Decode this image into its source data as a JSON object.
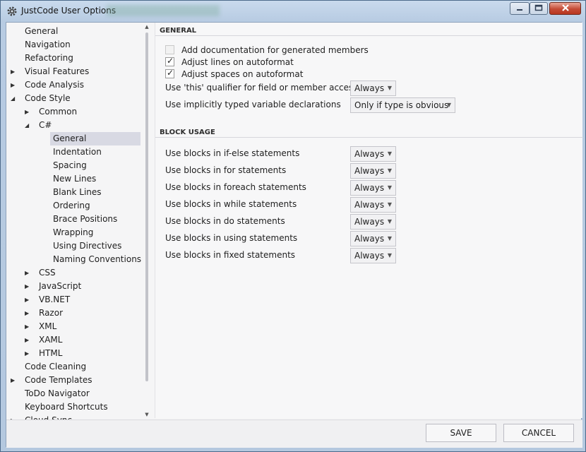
{
  "window": {
    "title": "JustCode User Options"
  },
  "tree": [
    {
      "label": "General",
      "indent": 0,
      "arrow": ""
    },
    {
      "label": "Navigation",
      "indent": 0,
      "arrow": ""
    },
    {
      "label": "Refactoring",
      "indent": 0,
      "arrow": ""
    },
    {
      "label": "Visual Features",
      "indent": 0,
      "arrow": "▶"
    },
    {
      "label": "Code Analysis",
      "indent": 0,
      "arrow": "▶"
    },
    {
      "label": "Code Style",
      "indent": 0,
      "arrow": "◢"
    },
    {
      "label": "Common",
      "indent": 1,
      "arrow": "▶"
    },
    {
      "label": "C#",
      "indent": 1,
      "arrow": "◢"
    },
    {
      "label": "General",
      "indent": 2,
      "arrow": "",
      "selected": true
    },
    {
      "label": "Indentation",
      "indent": 2,
      "arrow": ""
    },
    {
      "label": "Spacing",
      "indent": 2,
      "arrow": ""
    },
    {
      "label": "New Lines",
      "indent": 2,
      "arrow": ""
    },
    {
      "label": "Blank Lines",
      "indent": 2,
      "arrow": ""
    },
    {
      "label": "Ordering",
      "indent": 2,
      "arrow": ""
    },
    {
      "label": "Brace Positions",
      "indent": 2,
      "arrow": ""
    },
    {
      "label": "Wrapping",
      "indent": 2,
      "arrow": ""
    },
    {
      "label": "Using Directives",
      "indent": 2,
      "arrow": ""
    },
    {
      "label": "Naming Conventions",
      "indent": 2,
      "arrow": ""
    },
    {
      "label": "CSS",
      "indent": 1,
      "arrow": "▶"
    },
    {
      "label": "JavaScript",
      "indent": 1,
      "arrow": "▶"
    },
    {
      "label": "VB.NET",
      "indent": 1,
      "arrow": "▶"
    },
    {
      "label": "Razor",
      "indent": 1,
      "arrow": "▶"
    },
    {
      "label": "XML",
      "indent": 1,
      "arrow": "▶"
    },
    {
      "label": "XAML",
      "indent": 1,
      "arrow": "▶"
    },
    {
      "label": "HTML",
      "indent": 1,
      "arrow": "▶"
    },
    {
      "label": "Code Cleaning",
      "indent": 0,
      "arrow": ""
    },
    {
      "label": "Code Templates",
      "indent": 0,
      "arrow": "▶"
    },
    {
      "label": "ToDo Navigator",
      "indent": 0,
      "arrow": ""
    },
    {
      "label": "Keyboard Shortcuts",
      "indent": 0,
      "arrow": ""
    },
    {
      "label": "Cloud Sync",
      "indent": 0,
      "arrow": "▶"
    }
  ],
  "general": {
    "header": "GENERAL",
    "checkboxes": [
      {
        "label": "Add documentation for generated members",
        "checked": false,
        "disabled": true
      },
      {
        "label": "Adjust lines on autoformat",
        "checked": true,
        "disabled": false
      },
      {
        "label": "Adjust spaces on autoformat",
        "checked": true,
        "disabled": false
      }
    ],
    "options": [
      {
        "label": "Use 'this' qualifier for field or member accesses",
        "value": "Always"
      },
      {
        "label": "Use implicitly typed variable declarations",
        "value": "Only if type is obvious"
      }
    ]
  },
  "block_usage": {
    "header": "BLOCK USAGE",
    "options": [
      {
        "label": "Use blocks in if-else statements",
        "value": "Always"
      },
      {
        "label": "Use blocks in for statements",
        "value": "Always"
      },
      {
        "label": "Use blocks in foreach statements",
        "value": "Always"
      },
      {
        "label": "Use blocks in while statements",
        "value": "Always"
      },
      {
        "label": "Use blocks in do statements",
        "value": "Always"
      },
      {
        "label": "Use blocks in using statements",
        "value": "Always"
      },
      {
        "label": "Use blocks in fixed statements",
        "value": "Always"
      }
    ]
  },
  "footer": {
    "save_label": "SAVE",
    "cancel_label": "CANCEL"
  },
  "icons": {
    "app": "gear-icon",
    "minimize": "minimize-icon",
    "maximize": "maximize-icon",
    "close": "close-icon",
    "check": "✓",
    "caret": "▼"
  }
}
